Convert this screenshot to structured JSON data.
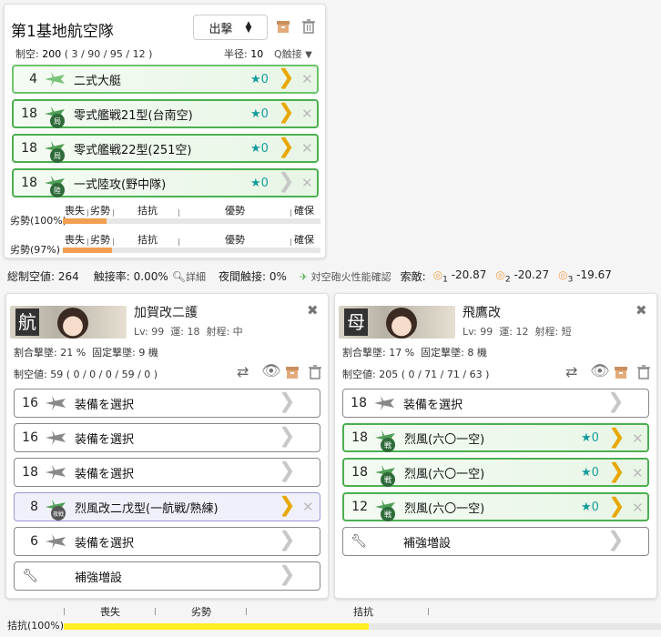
{
  "base": {
    "title": "第1基地航空隊",
    "sortie_label": "出撃",
    "air_label": "制空:",
    "air_value": "200",
    "air_detail": "( 3 / 90 / 95 / 12 )",
    "radius_label": "半径:",
    "radius_value": "10",
    "contact_label": "Q触接"
  },
  "base_slots": [
    {
      "count": "4",
      "name": "二式大艇",
      "star": "★0",
      "badge": ""
    },
    {
      "count": "18",
      "name": "零式艦戦21型(台南空)",
      "star": "★0",
      "badge": "局"
    },
    {
      "count": "18",
      "name": "零式艦戦22型(251空)",
      "star": "★0",
      "badge": "局"
    },
    {
      "count": "18",
      "name": "一式陸攻(野中隊)",
      "star": "★0",
      "badge": "陸"
    }
  ],
  "base_bars": [
    {
      "label": "劣勢(100%)",
      "m1": "喪失",
      "m2": "劣勢",
      "m3": "拮抗",
      "m4": "優勢",
      "m5": "確保",
      "fill": 0.17
    },
    {
      "label": "劣勢(97%)",
      "m1": "喪失",
      "m2": "劣勢",
      "m3": "拮抗",
      "m4": "優勢",
      "m5": "確保",
      "fill": 0.19
    }
  ],
  "summary": {
    "total": "総制空値: 264",
    "contact": "触接率: 0.00%",
    "detail": "詳細",
    "night": "夜間触接: 0%",
    "aa": "対空砲火性能確認",
    "enemy_label": "索敵:",
    "e1": "-20.87",
    "e2": "-20.27",
    "e3": "-19.67",
    "n1": "1",
    "n2": "2",
    "n3": "3"
  },
  "ships": [
    {
      "name": "加賀改二護",
      "lv": "Lv: 99",
      "luck": "運: 18",
      "range": "射程: 中",
      "rate": "割合撃墜: 21 %",
      "fixed": "固定撃墜: 9 機",
      "air": "制空値: 59 ( 0 / 0 / 0 / 59 / 0 )",
      "imgtext": "航",
      "slots": [
        {
          "count": "16",
          "name": "装備を選択",
          "type": "empty"
        },
        {
          "count": "16",
          "name": "装備を選択",
          "type": "empty"
        },
        {
          "count": "18",
          "name": "装備を選択",
          "type": "empty"
        },
        {
          "count": "8",
          "name": "烈風改二戊型(一航戦/熟練)",
          "type": "purple"
        },
        {
          "count": "6",
          "name": "装備を選択",
          "type": "empty"
        },
        {
          "count": "",
          "name": "補強増設",
          "type": "wrench"
        }
      ]
    },
    {
      "name": "飛鷹改",
      "lv": "Lv: 99",
      "luck": "運: 12",
      "range": "射程: 短",
      "rate": "割合撃墜: 17 %",
      "fixed": "固定撃墜: 8 機",
      "air": "制空値: 205 ( 0 / 71 / 71 / 63 )",
      "imgtext": "母",
      "slots": [
        {
          "count": "18",
          "name": "装備を選択",
          "type": "empty"
        },
        {
          "count": "18",
          "name": "烈風(六〇一空)",
          "type": "green",
          "star": "★0"
        },
        {
          "count": "18",
          "name": "烈風(六〇一空)",
          "type": "green",
          "star": "★0"
        },
        {
          "count": "12",
          "name": "烈風(六〇一空)",
          "type": "green",
          "star": "★0"
        },
        {
          "count": "",
          "name": "補強増設",
          "type": "wrench"
        }
      ]
    }
  ],
  "bottom": {
    "label": "拮抗(100%)",
    "m1": "喪失",
    "m2": "劣勢",
    "m3": "拮抗",
    "fill": 0.51
  },
  "colors": {
    "accent": "#4caf50",
    "gold": "#e8a800",
    "orange": "#f0a050",
    "yellow": "#ffee22"
  }
}
